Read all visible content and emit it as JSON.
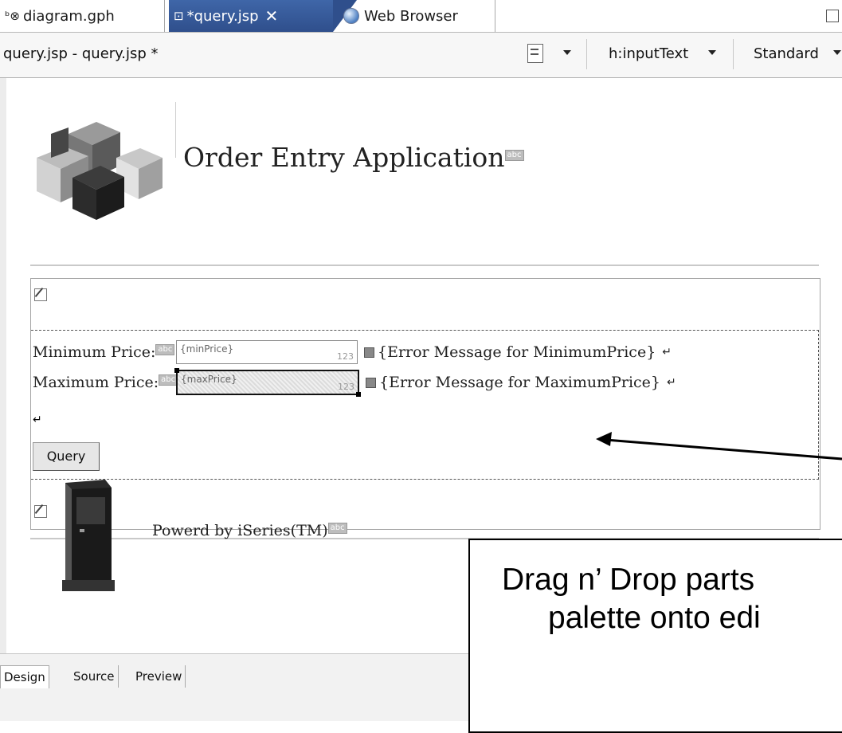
{
  "tabs": [
    {
      "label": "diagram.gph",
      "icon": "diagram-icon",
      "active": false
    },
    {
      "label": "*query.jsp",
      "icon": "jsp-file-icon",
      "active": true,
      "close": "✕"
    },
    {
      "label": "Web Browser",
      "icon": "globe-icon",
      "active": false
    }
  ],
  "toolbar": {
    "file_title": "query.jsp - query.jsp *",
    "component": "h:inputText",
    "mode": "Standard"
  },
  "page": {
    "title": "Order Entry Application",
    "abc_marker": "abc",
    "min_label": "Minimum Price:",
    "max_label": "Maximum Price:",
    "min_value": "{minPrice}",
    "max_value": "{maxPrice}",
    "num_marker": "123",
    "min_error": "{Error Message for MinimumPrice}",
    "max_error": "{Error Message for MaximumPrice}",
    "return_mark": "↵",
    "query_button": "Query",
    "powered": "Powerd by iSeries(TM)"
  },
  "callout": {
    "line1": "Drag n’ Drop parts",
    "line2": "palette onto edi"
  },
  "bottom_tabs": [
    "Design",
    "Source",
    "Preview"
  ],
  "colors": {
    "active_tab": "#3f66a8"
  }
}
